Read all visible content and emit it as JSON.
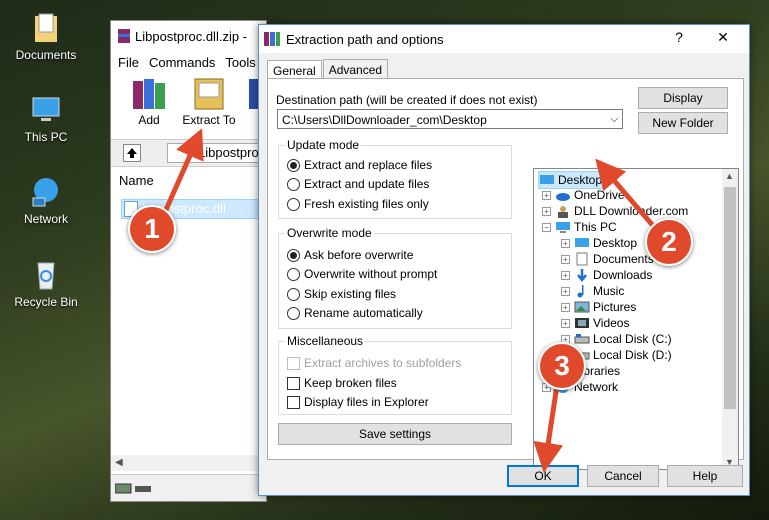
{
  "desktop": {
    "icons": [
      {
        "label": "Documents"
      },
      {
        "label": "This PC"
      },
      {
        "label": "Network"
      },
      {
        "label": "Recycle Bin"
      }
    ]
  },
  "winrar": {
    "title": "Libpostproc.dll.zip -",
    "menu": [
      "File",
      "Commands",
      "Tools"
    ],
    "tools": {
      "add": "Add",
      "extract": "Extract To"
    },
    "path": "Libpostproc",
    "column_name": "Name",
    "file": "Libpostproc.dll"
  },
  "dialog": {
    "title": "Extraction path and options",
    "help_glyph": "?",
    "close_glyph": "✕",
    "tabs": [
      "General",
      "Advanced"
    ],
    "dest_label": "Destination path (will be created if does not exist)",
    "dest_value": "C:\\Users\\DllDownloader_com\\Desktop",
    "display_button": "Display",
    "new_folder_button": "New Folder",
    "update_mode": {
      "legend": "Update mode",
      "options": [
        "Extract and replace files",
        "Extract and update files",
        "Fresh existing files only"
      ],
      "selected": 0
    },
    "overwrite_mode": {
      "legend": "Overwrite mode",
      "options": [
        "Ask before overwrite",
        "Overwrite without prompt",
        "Skip existing files",
        "Rename automatically"
      ],
      "selected": 0
    },
    "misc": {
      "legend": "Miscellaneous",
      "options": [
        "Extract archives to subfolders",
        "Keep broken files",
        "Display files in Explorer"
      ]
    },
    "save_settings": "Save settings",
    "tree": [
      "Desktop",
      "OneDrive",
      "DLL Downloader.com",
      "This PC",
      "Desktop",
      "Documents",
      "Downloads",
      "Music",
      "Pictures",
      "Videos",
      "Local Disk (C:)",
      "Local Disk (D:)",
      "Libraries",
      "Network"
    ],
    "ok": "OK",
    "cancel": "Cancel",
    "help": "Help"
  },
  "callouts": [
    "1",
    "2",
    "3"
  ],
  "colors": {
    "callout": "#e0492c",
    "selection": "#cce8ff",
    "dialog_border": "#5a8fd1"
  }
}
